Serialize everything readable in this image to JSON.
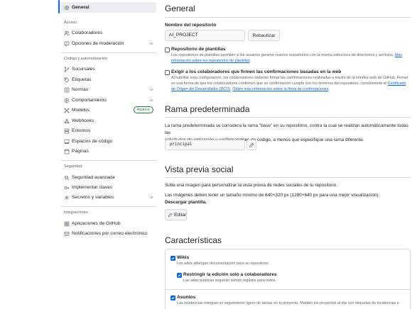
{
  "sidebar": {
    "general": "General",
    "sections": {
      "access": "Acceso",
      "code": "Código y automatización",
      "security": "Seguridad",
      "integrations": "Integraciones"
    },
    "items": {
      "collaborators": "Colaboradores",
      "moderation": "Opciones de moderación",
      "branches": "Sucursales",
      "tags": "Etiquetas",
      "rules": "Normas",
      "behavior": "Comportamiento",
      "models": "Modelos",
      "models_badge": "Avance",
      "webhooks": "Webhooks",
      "environments": "Entornos",
      "codespaces": "Espacios de código",
      "pages": "Páginas",
      "advanced_security": "Seguridad avanzada",
      "deploy_keys": "Implementar claves",
      "secrets": "Secretos y variables",
      "github_apps": "Aplicaciones de GitHub",
      "email_notifications": "Notificaciones por correo electrónico"
    }
  },
  "general": {
    "title": "General",
    "repo_name_label": "Nombre del repositorio",
    "repo_name_value": "AI_PROJECT",
    "rename_button": "Rebautizar",
    "template": {
      "label": "Repositorio de plantillas",
      "desc": "Los repositorios de plantillas permiten a los usuarios generar nuevos repositorios con la misma estructura de directorios y archivos.",
      "link_a": "Más",
      "link_b": "información sobre los repositorios de plantillas",
      "end": "."
    },
    "signoff": {
      "label": "Exigir a los colaboradores que firmen las confirmaciones basadas en la web",
      "desc1": "Al habilitar esta configuración, los colaboradores deberán firmar las confirmaciones realizadas a través de la interfaz web de GitHub. Firmar",
      "desc2": "es una forma de que los colaboradores confirmen que su confirmación cumple con los términos del repositorio, comúnmente el",
      "link1a": "Certificado",
      "link1b": "de Origen del Desarrollador (DCO)",
      "mid": ".",
      "link2": "Obtén más información sobre la firma de confirmaciones",
      "end": "."
    }
  },
  "default_branch": {
    "title": "Rama predeterminada",
    "desc1": "La rama predeterminada se considera la rama \"base\" en su repositorio, contra la cual se realizan automáticamente todas las",
    "desc2": "solicitudes de extracción y confirmaciones de código, a menos que especifique una rama diferente.",
    "branch": "principal"
  },
  "social_preview": {
    "title": "Vista previa social",
    "desc1": "Sube una imagen para personalizar la vista previa de redes sociales de tu repositorio.",
    "desc2": "Las imágenes deben tener un tamaño mínimo de 640×320 px (1280×640 px para una mejor visualización).",
    "download_link": "Descargar plantilla.",
    "edit_button": "Editar"
  },
  "features": {
    "title": "Características",
    "wikis": {
      "label": "Wikis",
      "desc": "Los wikis albergan documentación para su repositorio.",
      "checked": true
    },
    "restrict": {
      "label": "Restringir la edición solo a colaboradores",
      "desc": "Las wikis públicas seguirán siendo legibles para todos.",
      "checked": true
    },
    "issues": {
      "label": "Asuntos",
      "desc": "Las incidencias integran un seguimiento ligero de tareas en tu proyecto. Mantén los proyectos al día con etiquetas de incidencias e",
      "checked": true
    }
  }
}
